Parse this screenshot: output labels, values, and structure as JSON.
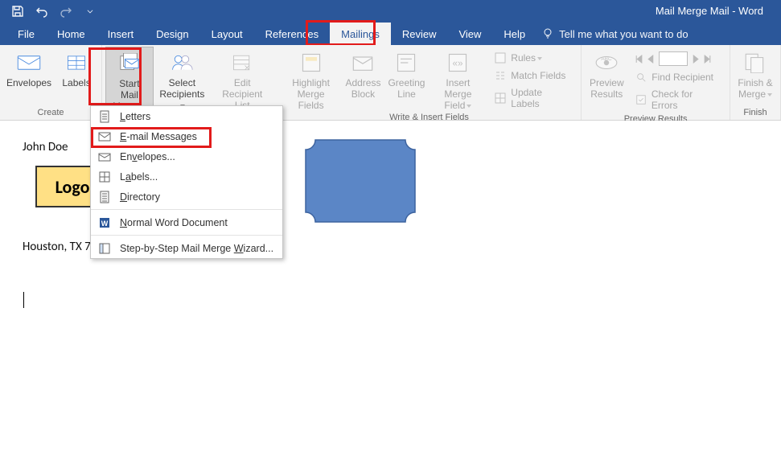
{
  "title": "Mail Merge Mail  -  Word",
  "tabs": {
    "file": "File",
    "home": "Home",
    "insert": "Insert",
    "design": "Design",
    "layout": "Layout",
    "references": "References",
    "mailings": "Mailings",
    "review": "Review",
    "view": "View",
    "help": "Help"
  },
  "tellme": "Tell me what you want to do",
  "ribbon": {
    "create": {
      "label": "Create",
      "envelopes": "Envelopes",
      "labels": "Labels"
    },
    "start": {
      "start_mail_merge": "Start Mail\nMerge",
      "select_recipients": "Select\nRecipients",
      "edit_recipient_list": "Edit\nRecipient List"
    },
    "write": {
      "label": "Write & Insert Fields",
      "highlight": "Highlight\nMerge Fields",
      "address_block": "Address\nBlock",
      "greeting_line": "Greeting\nLine",
      "insert_merge_field": "Insert Merge\nField",
      "rules": "Rules",
      "match_fields": "Match Fields",
      "update_labels": "Update Labels"
    },
    "preview": {
      "label": "Preview Results",
      "preview_results": "Preview\nResults",
      "find_recipient": "Find Recipient",
      "check_errors": "Check for Errors"
    },
    "finish": {
      "label": "Finish",
      "finish_merge": "Finish &\nMerge"
    }
  },
  "menu": {
    "letters_pre": "",
    "letters_u": "L",
    "letters_post": "etters",
    "email_pre": "",
    "email_u": "E",
    "email_post": "-mail Messages",
    "envelopes_pre": "En",
    "envelopes_u": "v",
    "envelopes_post": "elopes...",
    "labels_pre": "L",
    "labels_u": "a",
    "labels_post": "bels...",
    "directory_pre": "",
    "directory_u": "D",
    "directory_post": "irectory",
    "normal_pre": "",
    "normal_u": "N",
    "normal_post": "ormal Word Document",
    "wizard_pre": "Step-by-Step Mail Merge ",
    "wizard_u": "W",
    "wizard_post": "izard..."
  },
  "doc": {
    "john": "John Doe",
    "logo": "Logo",
    "houston": "Houston, TX 7"
  }
}
